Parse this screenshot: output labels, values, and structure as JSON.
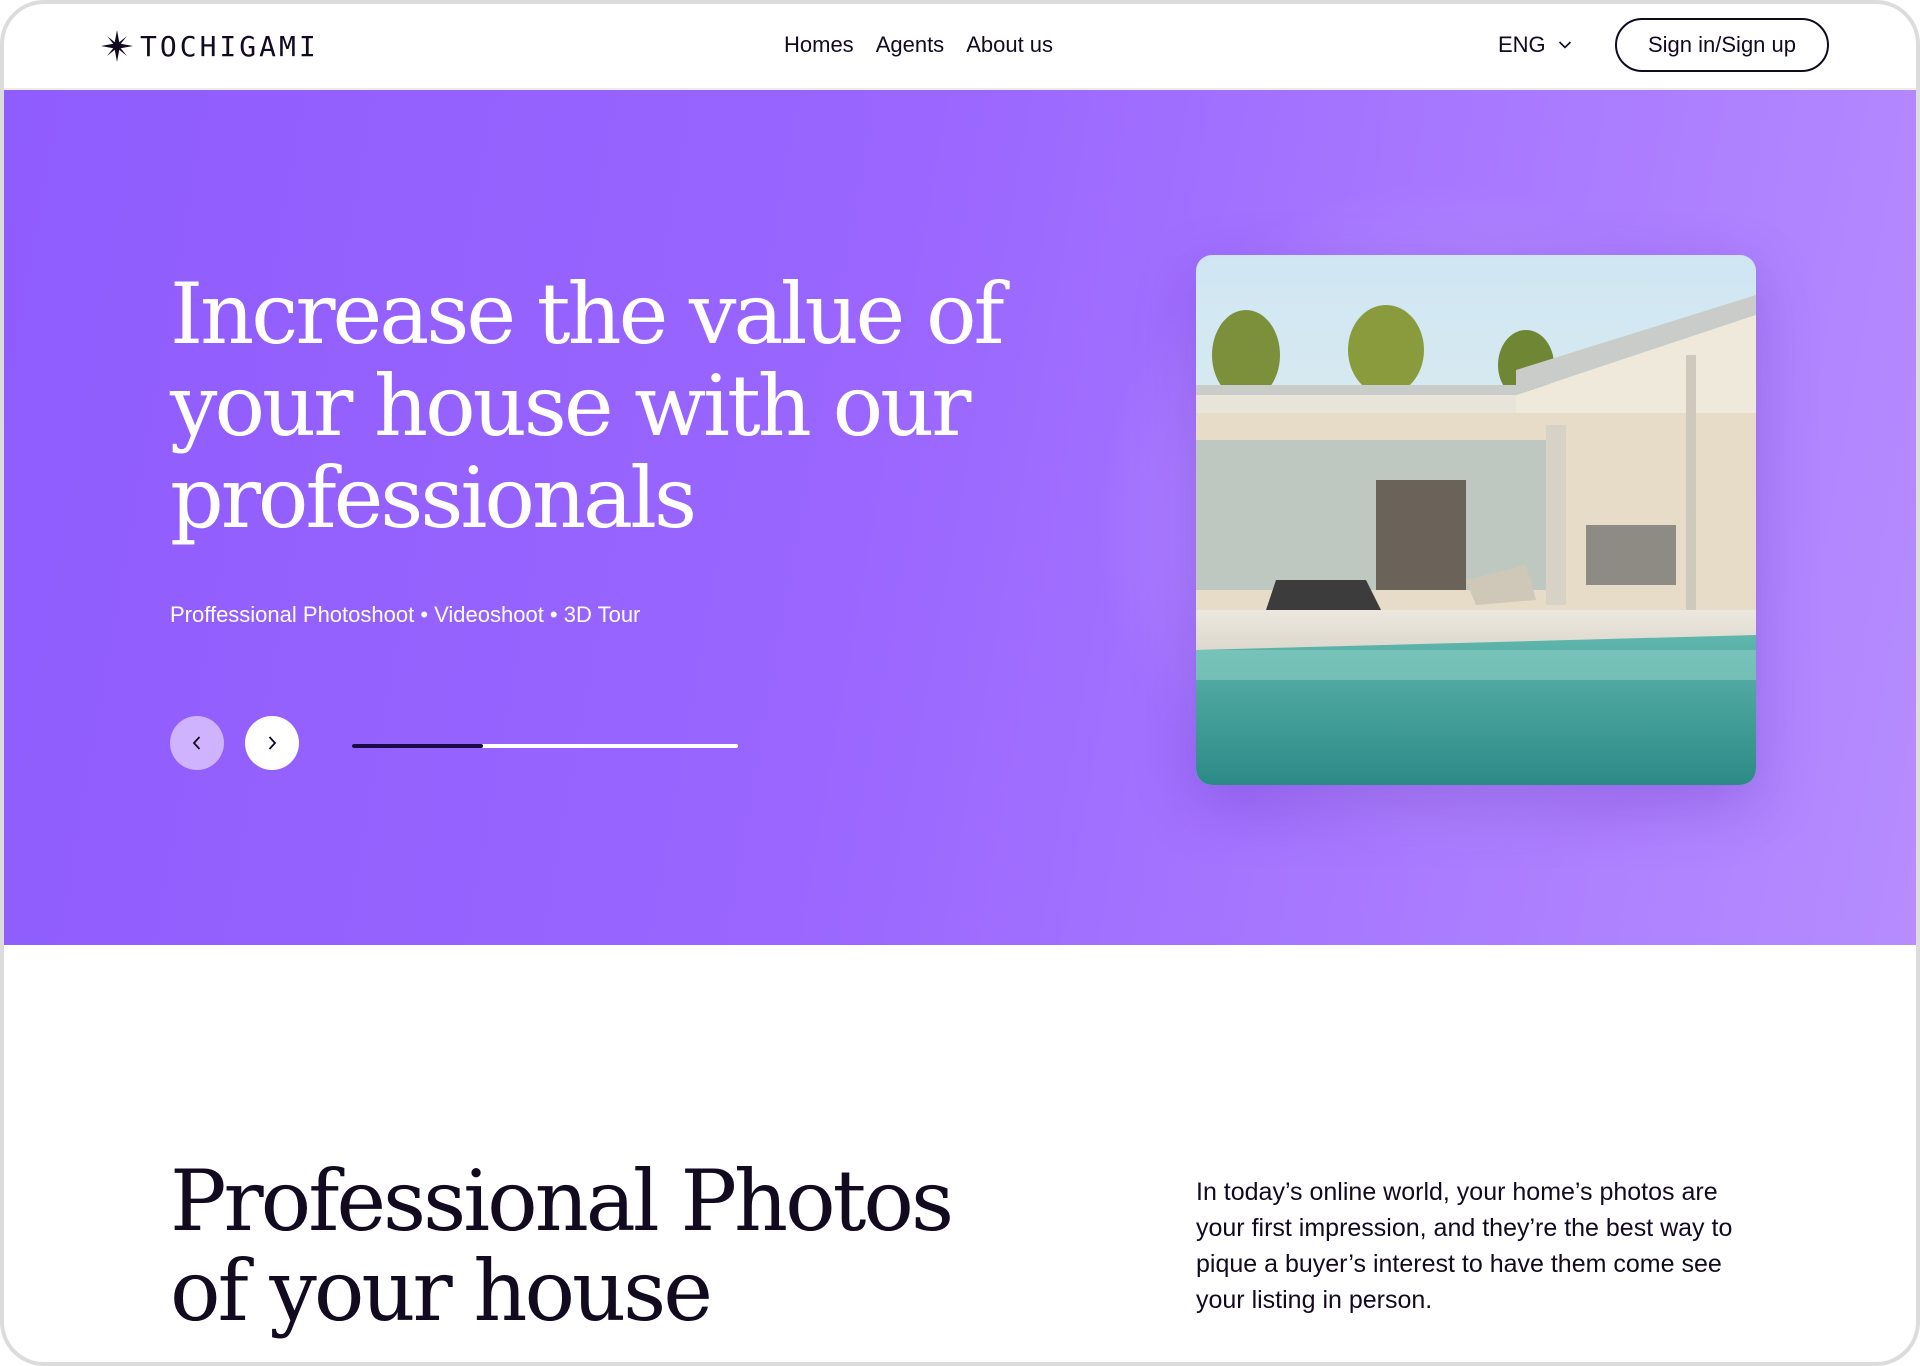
{
  "brand": {
    "name": "TOCHIGAMI"
  },
  "nav": {
    "items": [
      {
        "label": "Homes"
      },
      {
        "label": "Agents"
      },
      {
        "label": "About us"
      }
    ]
  },
  "header": {
    "language": "ENG",
    "signin_label": "Sign in/Sign up"
  },
  "hero": {
    "title": "Increase the value of your house with our professionals",
    "subtitle": "Proffessional Photoshoot • Videoshoot • 3D Tour",
    "carousel_progress": 0.34,
    "image_alt": "modern house with pool"
  },
  "section": {
    "title": "Professional Photos of your house",
    "text": "In today’s online world, your home’s photos are your first impression, and they’re the best way to pique a buyer’s interest to have them come see your listing in person."
  },
  "colors": {
    "accent": "#9a66ff",
    "dark": "#120a1f",
    "progress_fill": "#1b0a45"
  },
  "icons": {
    "logo": "sparkle-star-icon",
    "language": "chevron-down-icon",
    "prev": "chevron-left-icon",
    "next": "chevron-right-icon"
  }
}
